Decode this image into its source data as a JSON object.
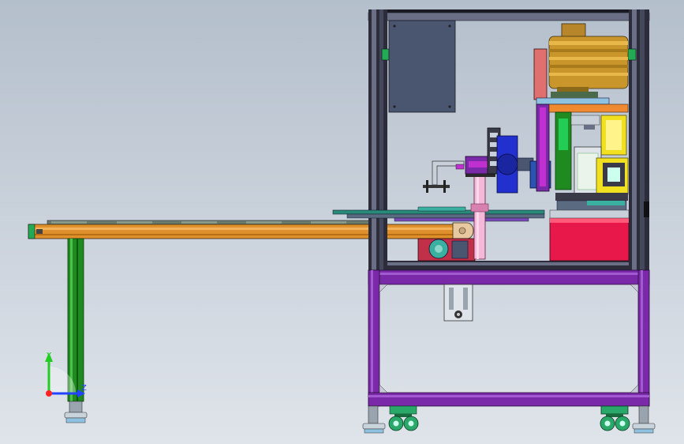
{
  "axes": {
    "y_label": "Y",
    "z_label": "Z",
    "colors": {
      "y": "#22cc22",
      "z": "#2244ff",
      "origin": "#ff2222"
    }
  },
  "palette": {
    "frame": "#2c2c3a",
    "frame_light": "#6a6f86",
    "purple": "#7a2aa8",
    "conveyor_orange": "#e0902a",
    "leg_green": "#1f8a1f",
    "motor_gold": "#c8962a",
    "panel_slate": "#4a5670",
    "red_block": "#e8184a",
    "blue": "#2230d0",
    "magenta": "#c030d0",
    "yellow": "#f0e020",
    "teal": "#3ab0a0",
    "wheel": "#2aa86a"
  }
}
